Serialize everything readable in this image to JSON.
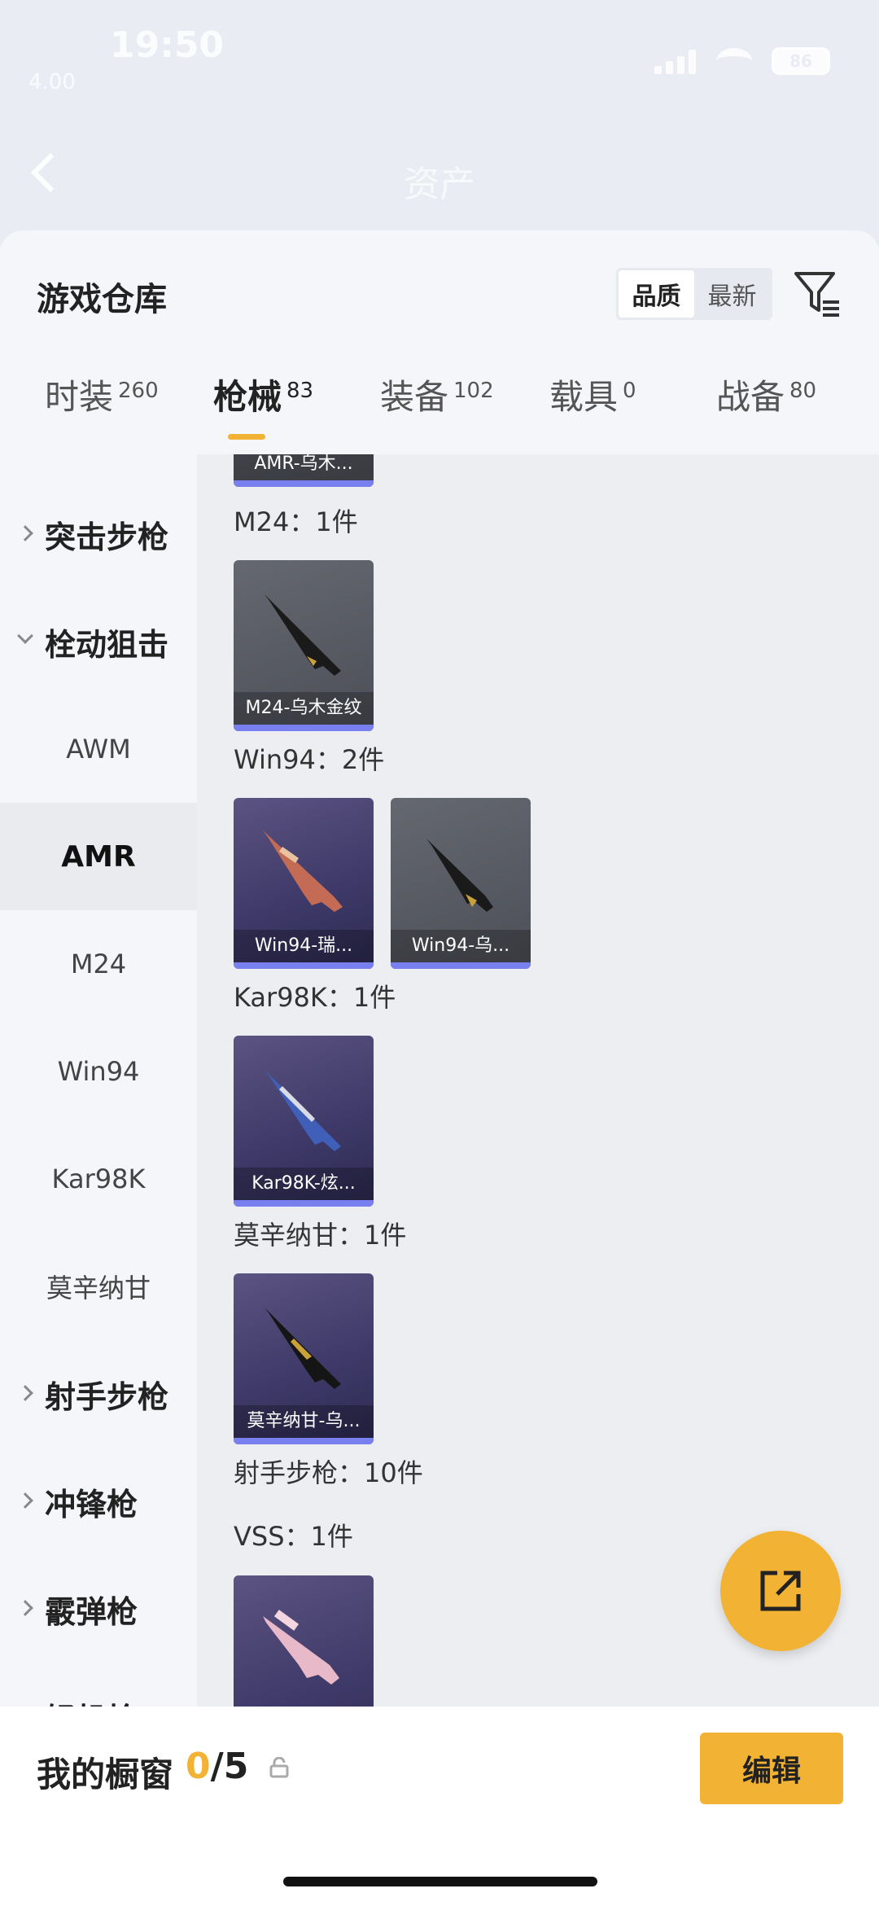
{
  "status_bar": {
    "time": "19:50",
    "small_text": "4.00",
    "battery": "86"
  },
  "header": {
    "title": "资产"
  },
  "sheet": {
    "title": "游戏仓库",
    "sort_options": [
      "品质",
      "最新"
    ],
    "sort_selected": "品质"
  },
  "tabs": [
    {
      "label": "时装",
      "count": "260"
    },
    {
      "label": "枪械",
      "count": "83"
    },
    {
      "label": "装备",
      "count": "102"
    },
    {
      "label": "载具",
      "count": "0"
    },
    {
      "label": "战备",
      "count": "80"
    }
  ],
  "active_tab": "枪械",
  "sidebar": {
    "items": [
      {
        "label": "突击步枪",
        "kind": "group",
        "expanded": false
      },
      {
        "label": "栓动狙击",
        "kind": "group",
        "expanded": true
      },
      {
        "label": "AWM",
        "kind": "sub"
      },
      {
        "label": "AMR",
        "kind": "sub",
        "selected": true
      },
      {
        "label": "M24",
        "kind": "sub"
      },
      {
        "label": "Win94",
        "kind": "sub"
      },
      {
        "label": "Kar98K",
        "kind": "sub"
      },
      {
        "label": "莫辛纳甘",
        "kind": "sub"
      },
      {
        "label": "射手步枪",
        "kind": "group",
        "expanded": false
      },
      {
        "label": "冲锋枪",
        "kind": "group",
        "expanded": false
      },
      {
        "label": "霰弹枪",
        "kind": "group",
        "expanded": false
      },
      {
        "label": "轻机枪",
        "kind": "group",
        "expanded": false
      }
    ]
  },
  "content": {
    "partial_card": {
      "name": "AMR-乌木..."
    },
    "groups": [
      {
        "label": "M24：1件",
        "cards": [
          {
            "name": "M24-乌木金纹",
            "style": "gray"
          }
        ]
      },
      {
        "label": "Win94：2件",
        "cards": [
          {
            "name": "Win94-瑞...",
            "style": "purple"
          },
          {
            "name": "Win94-乌...",
            "style": "gray"
          }
        ]
      },
      {
        "label": "Kar98K：1件",
        "cards": [
          {
            "name": "Kar98K-炫...",
            "style": "purple"
          }
        ]
      },
      {
        "label": "莫辛纳甘：1件",
        "cards": [
          {
            "name": "莫辛纳甘-乌...",
            "style": "purple"
          }
        ]
      }
    ],
    "category_total": "射手步枪：10件",
    "vss_label": "VSS：1件"
  },
  "bottom": {
    "showcase_label": "我的橱窗",
    "showcase_current": "0",
    "showcase_total": "/5",
    "edit_label": "编辑"
  },
  "colors": {
    "accent": "#f2b233",
    "rarity_bar": "#7a7ff0"
  },
  "icons": [
    "back-arrow-icon",
    "filter-icon",
    "share-icon",
    "lock-icon",
    "chevron-right-icon",
    "chevron-down-icon"
  ]
}
